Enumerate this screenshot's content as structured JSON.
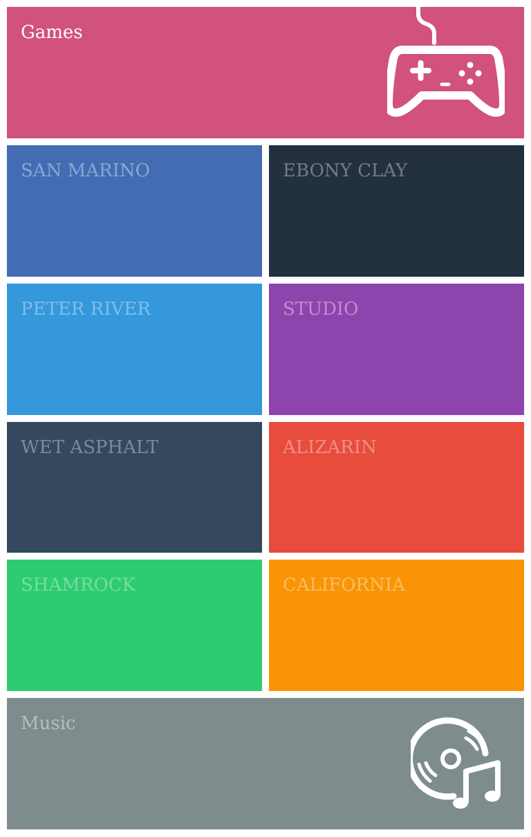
{
  "tiles": {
    "games": {
      "label": "Games",
      "bg": "#d1527c",
      "fg": "#ffffff",
      "icon": "gamepad-icon"
    },
    "san_marino": {
      "label": "SAN MARINO",
      "bg": "#436cb2",
      "fg": "#8aa6d6"
    },
    "ebony_clay": {
      "label": "EBONY CLAY",
      "bg": "#22303f",
      "fg": "#727c87"
    },
    "peter_river": {
      "label": "PETER RIVER",
      "bg": "#3498db",
      "fg": "#80bdea"
    },
    "studio": {
      "label": "STUDIO",
      "bg": "#8e44ad",
      "fg": "#bb90cf"
    },
    "wet_asphalt": {
      "label": "WET ASPHALT",
      "bg": "#34495e",
      "fg": "#7d8a97"
    },
    "alizarin": {
      "label": "ALIZARIN",
      "bg": "#e74c3c",
      "fg": "#f08f84"
    },
    "shamrock": {
      "label": "SHAMROCK",
      "bg": "#2ecc71",
      "fg": "#77dca2"
    },
    "california": {
      "label": "CALIFORNIA",
      "bg": "#f89406",
      "fg": "#fbbd63"
    },
    "music": {
      "label": "Music",
      "bg": "#7f8c8d",
      "fg": "#b6bebe",
      "icon": "music-disc-icon"
    }
  }
}
